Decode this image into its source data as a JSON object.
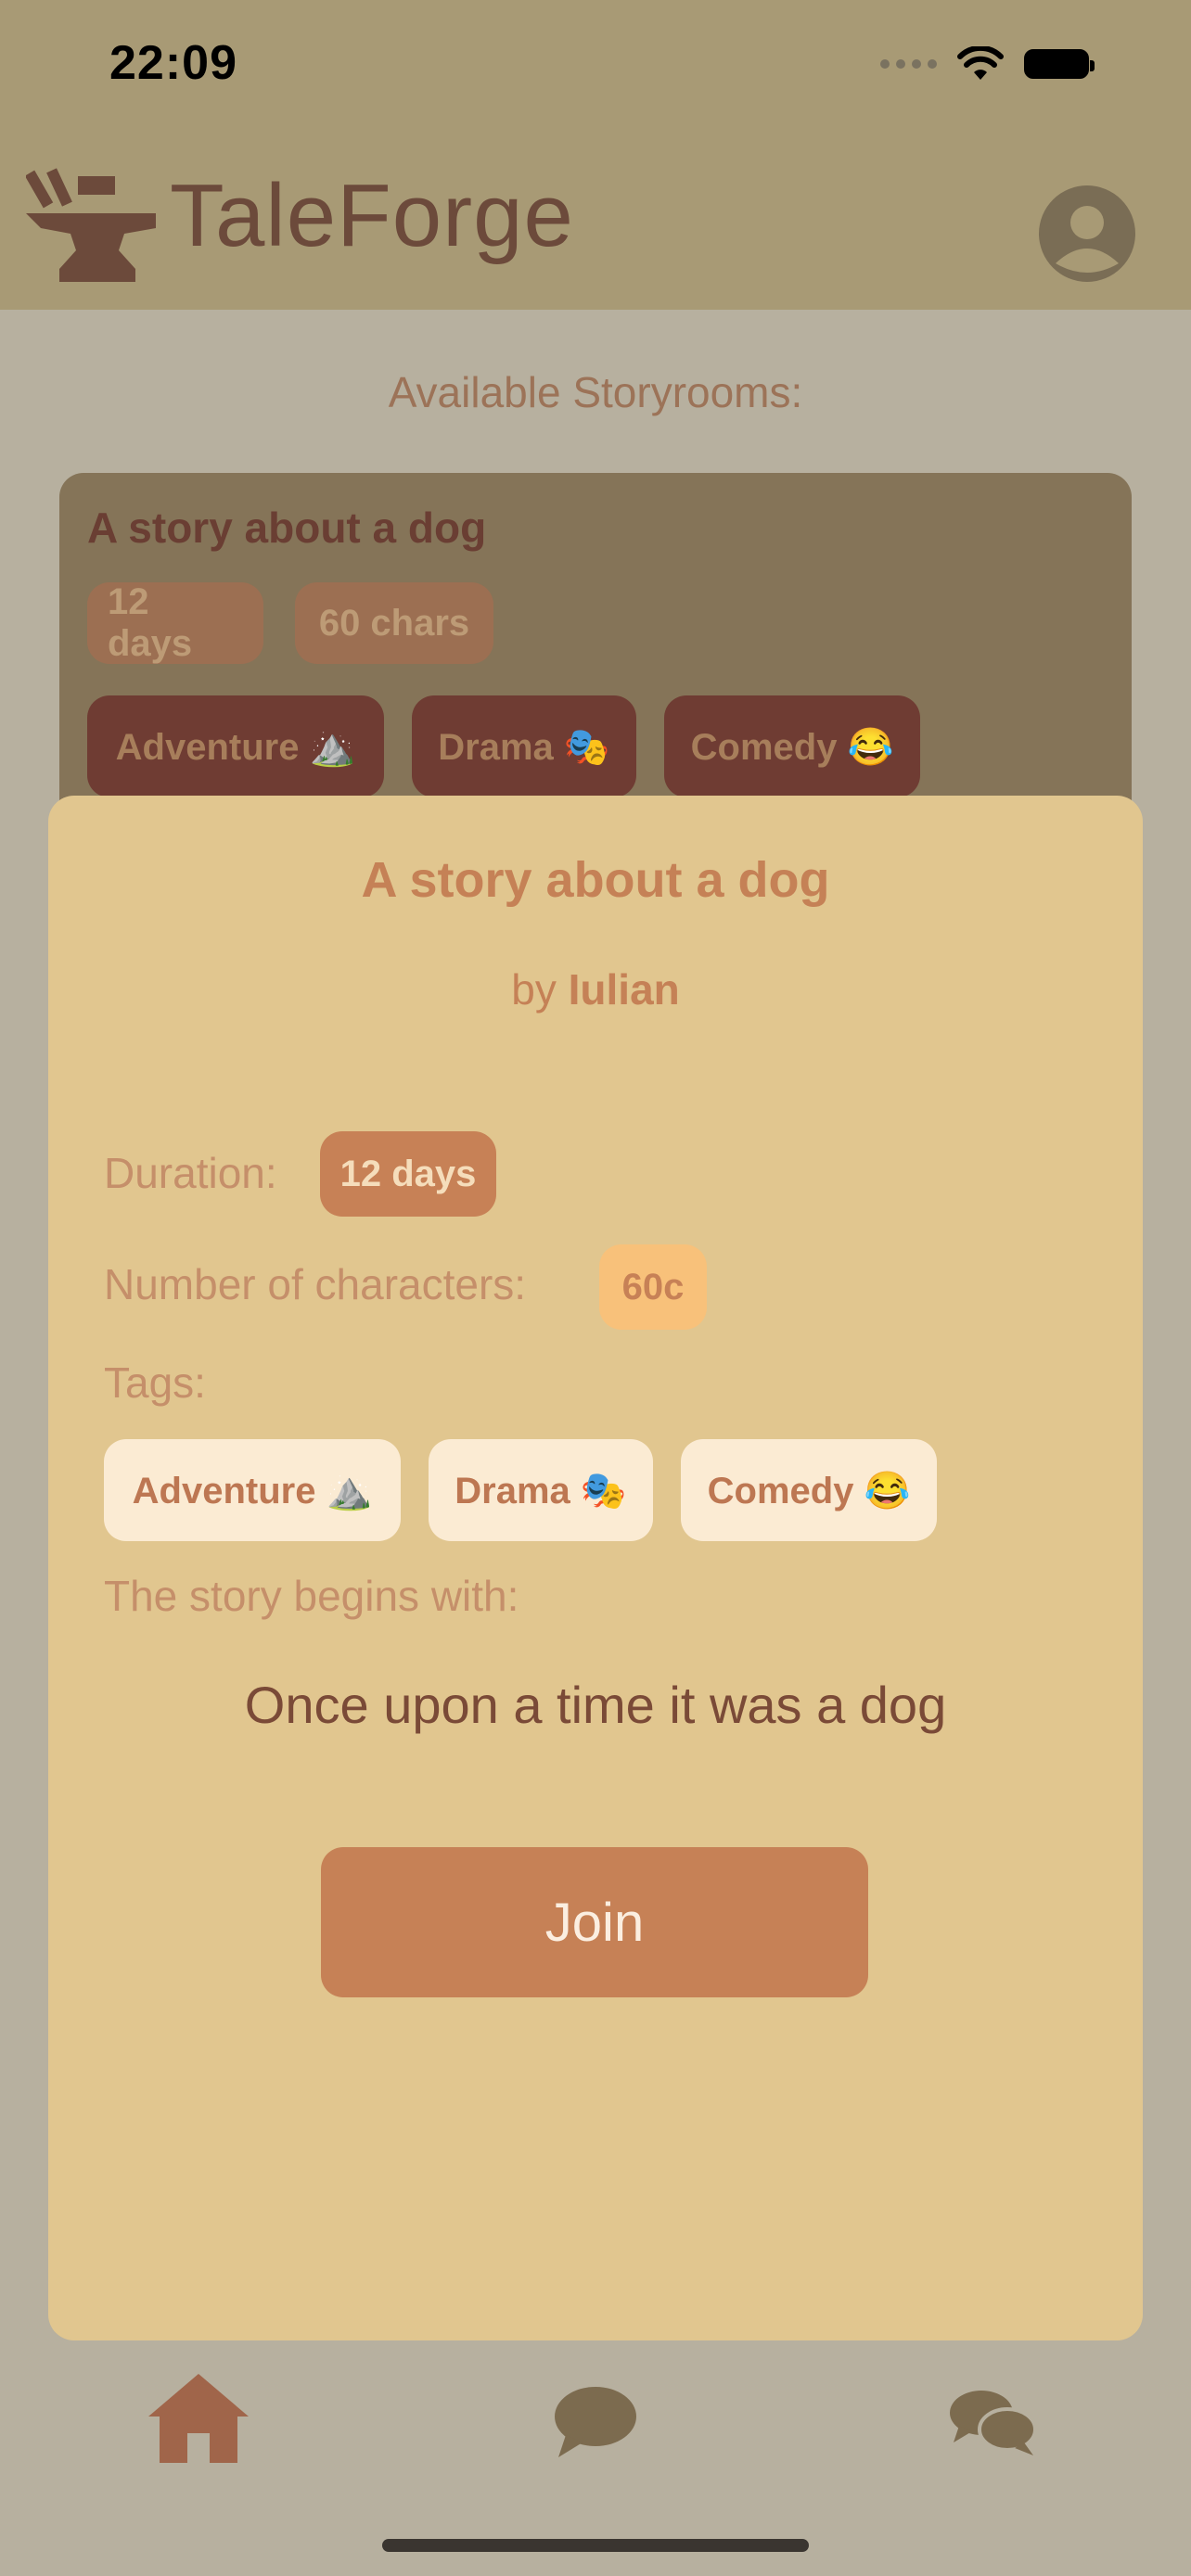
{
  "status_bar": {
    "time": "22:09"
  },
  "header": {
    "app_title": "TaleForge",
    "logo_icon": "anvil-icon",
    "profile_icon": "user-avatar-icon"
  },
  "list": {
    "section_title": "Available Storyrooms:",
    "cards": [
      {
        "title": "A story about a dog",
        "duration": "12 days",
        "characters": "60 chars",
        "tags": [
          "Adventure ⛰️",
          "Drama 🎭",
          "Comedy 😂"
        ]
      }
    ]
  },
  "modal": {
    "title": "A story about a dog",
    "by_prefix": "by",
    "author": "Iulian",
    "duration_label": "Duration:",
    "duration_value": "12 days",
    "characters_label": "Number of characters:",
    "characters_value": "60c",
    "tags_label": "Tags:",
    "tags": [
      "Adventure ⛰️",
      "Drama 🎭",
      "Comedy 😂"
    ],
    "begins_label": "The story begins with:",
    "opening_text": "Once upon a time it was a dog",
    "join_label": "Join"
  },
  "tab_bar": {
    "items": [
      {
        "icon": "home-icon",
        "active": true
      },
      {
        "icon": "chat-bubble-icon",
        "active": false
      },
      {
        "icon": "chat-bubbles-icon",
        "active": false
      }
    ]
  },
  "colors": {
    "header_bg": "#a89a75",
    "modal_bg": "#e1c68f",
    "accent": "#c68156"
  }
}
